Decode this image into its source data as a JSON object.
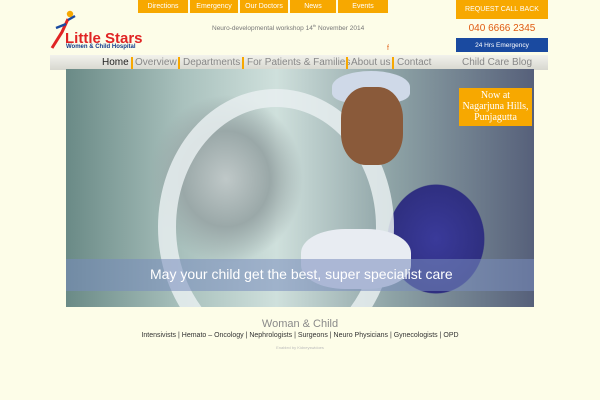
{
  "header": {
    "logo_name": "Little Stars",
    "logo_sub": "Women & Child Hospital",
    "top_links": [
      "Directions",
      "Emergency",
      "Our Doctors",
      "News",
      "Events"
    ],
    "tagline": "Neuro-developmental workshop 14",
    "tagline_sup": "th",
    "tagline_rest": " November 2014",
    "callback_label": "REQUEST CALL BACK",
    "phone": "040 6666 2345",
    "emergency_label": "24 Hrs Emergency",
    "fb_glyph": "f"
  },
  "nav": {
    "items": [
      "Home",
      "Overview",
      "Departments",
      "For Patients & Families",
      "About us",
      "Contact",
      "Child Care Blog"
    ],
    "active": "Home"
  },
  "hero": {
    "caption": "May your child get the best, super specialist care",
    "now_at_line1": "Now at",
    "now_at_line2": "Nagarjuna Hills,",
    "now_at_line3": "Punjagutta"
  },
  "footer": {
    "title": "Woman & Child",
    "services": "Intensivists | Hemato – Oncology | Nephrologists | Surgeons | Neuro Physicians | Gynecologists | OPD",
    "credit": "Enabled by Kidneyswidoes"
  },
  "colors": {
    "accent": "#f7a800",
    "brand_blue": "#1a4aa0",
    "background": "#fdfde8"
  }
}
